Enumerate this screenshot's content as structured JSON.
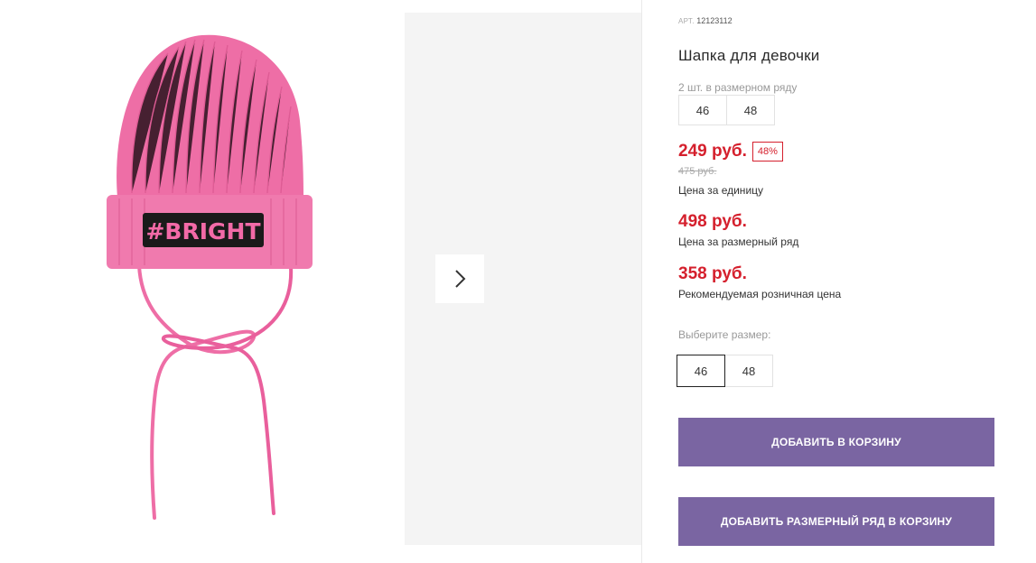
{
  "product": {
    "article_label": "АРТ.",
    "article_number": "12123112",
    "title": "Шапка для девочки",
    "row_note": "2 шт. в размерном ряду",
    "row_sizes": [
      "46",
      "48"
    ],
    "image_text": "#BRIGHT"
  },
  "pricing": {
    "unit_price": "249 руб.",
    "discount": "48%",
    "old_price": "475 руб.",
    "unit_caption": "Цена за единицу",
    "row_price": "498 руб.",
    "row_caption": "Цена за размерный ряд",
    "rrp_price": "358 руб.",
    "rrp_caption": "Рекомендуемая розничная цена"
  },
  "size_picker": {
    "label": "Выберите размер:",
    "options": [
      "46",
      "48"
    ],
    "selected": "46"
  },
  "buttons": {
    "add_to_cart": "ДОБАВИТЬ В КОРЗИНУ",
    "add_row_to_cart": "ДОБАВИТЬ РАЗМЕРНЫЙ РЯД В КОРЗИНУ"
  },
  "colors": {
    "accent_button": "#7a65a2",
    "price_red": "#d5202d",
    "hat_pink": "#ee6ea6"
  },
  "icons": {
    "gallery_next": "chevron-right-icon"
  }
}
